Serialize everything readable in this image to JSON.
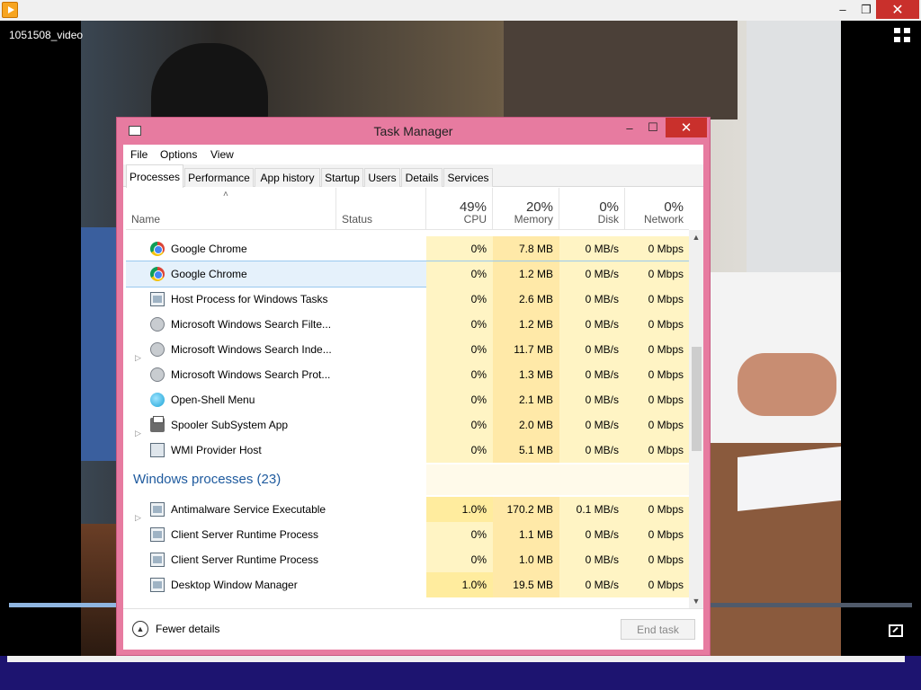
{
  "player": {
    "window_controls": {
      "minimize": "–",
      "restore": "❐",
      "close": "✕"
    },
    "video_title": "1051508_video",
    "seek_progress_fraction": 0.12
  },
  "task_manager": {
    "title": "Task Manager",
    "window_controls": {
      "minimize": "–",
      "maximize": "☐",
      "close": "✕"
    },
    "menu": [
      "File",
      "Options",
      "View"
    ],
    "tabs": [
      "Processes",
      "Performance",
      "App history",
      "Startup",
      "Users",
      "Details",
      "Services"
    ],
    "active_tab": "Processes",
    "columns": {
      "name": "Name",
      "status": "Status",
      "cpu": {
        "percent": "49%",
        "label": "CPU"
      },
      "memory": {
        "percent": "20%",
        "label": "Memory"
      },
      "disk": {
        "percent": "0%",
        "label": "Disk"
      },
      "network": {
        "percent": "0%",
        "label": "Network"
      }
    },
    "rows_before_group": [
      {
        "name": "Google Chrome",
        "icon": "chrome-icon",
        "expandable": false,
        "cpu": "0%",
        "memory": "7.8 MB",
        "disk": "0 MB/s",
        "network": "0 Mbps",
        "selected": false
      },
      {
        "name": "Google Chrome",
        "icon": "chrome-icon",
        "expandable": false,
        "cpu": "0%",
        "memory": "1.2 MB",
        "disk": "0 MB/s",
        "network": "0 Mbps",
        "selected": true
      },
      {
        "name": "Host Process for Windows Tasks",
        "icon": "window-icon",
        "expandable": false,
        "cpu": "0%",
        "memory": "2.6 MB",
        "disk": "0 MB/s",
        "network": "0 Mbps",
        "selected": false
      },
      {
        "name": "Microsoft Windows Search Filte...",
        "icon": "user-icon",
        "expandable": false,
        "cpu": "0%",
        "memory": "1.2 MB",
        "disk": "0 MB/s",
        "network": "0 Mbps",
        "selected": false
      },
      {
        "name": "Microsoft Windows Search Inde...",
        "icon": "user-icon",
        "expandable": true,
        "cpu": "0%",
        "memory": "11.7 MB",
        "disk": "0 MB/s",
        "network": "0 Mbps",
        "selected": false
      },
      {
        "name": "Microsoft Windows Search Prot...",
        "icon": "user-icon",
        "expandable": false,
        "cpu": "0%",
        "memory": "1.3 MB",
        "disk": "0 MB/s",
        "network": "0 Mbps",
        "selected": false
      },
      {
        "name": "Open-Shell Menu",
        "icon": "shell-icon",
        "expandable": false,
        "cpu": "0%",
        "memory": "2.1 MB",
        "disk": "0 MB/s",
        "network": "0 Mbps",
        "selected": false
      },
      {
        "name": "Spooler SubSystem App",
        "icon": "printer-icon",
        "expandable": true,
        "cpu": "0%",
        "memory": "2.0 MB",
        "disk": "0 MB/s",
        "network": "0 Mbps",
        "selected": false
      },
      {
        "name": "WMI Provider Host",
        "icon": "wmi-icon",
        "expandable": false,
        "cpu": "0%",
        "memory": "5.1 MB",
        "disk": "0 MB/s",
        "network": "0 Mbps",
        "selected": false
      }
    ],
    "group_label": "Windows processes (23)",
    "rows_after_group": [
      {
        "name": "Antimalware Service Executable",
        "icon": "window-icon",
        "expandable": true,
        "cpu": "1.0%",
        "memory": "170.2 MB",
        "disk": "0.1 MB/s",
        "network": "0 Mbps"
      },
      {
        "name": "Client Server Runtime Process",
        "icon": "window-icon",
        "expandable": false,
        "cpu": "0%",
        "memory": "1.1 MB",
        "disk": "0 MB/s",
        "network": "0 Mbps"
      },
      {
        "name": "Client Server Runtime Process",
        "icon": "window-icon",
        "expandable": false,
        "cpu": "0%",
        "memory": "1.0 MB",
        "disk": "0 MB/s",
        "network": "0 Mbps"
      },
      {
        "name": "Desktop Window Manager",
        "icon": "window-icon",
        "expandable": false,
        "cpu": "1.0%",
        "memory": "19.5 MB",
        "disk": "0 MB/s",
        "network": "0 Mbps"
      }
    ],
    "footer": {
      "fewer_details": "Fewer details",
      "end_task": "End task"
    }
  }
}
